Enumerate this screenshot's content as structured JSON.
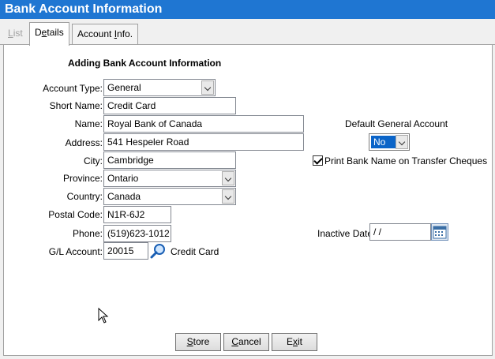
{
  "window": {
    "title": "Bank Account Information"
  },
  "tabs": {
    "list": {
      "first": "L",
      "rest": "ist"
    },
    "details": {
      "pre": "D",
      "mid": "e",
      "rest": "tails"
    },
    "account_info": {
      "pre": "Account ",
      "mid": "I",
      "rest": "nfo."
    }
  },
  "form": {
    "section_title": "Adding Bank Account Information",
    "account_type": {
      "label": "Account Type:",
      "value": "General"
    },
    "short_name": {
      "label": "Short Name:",
      "value": "Credit Card"
    },
    "name": {
      "label": "Name:",
      "value": "Royal Bank of Canada"
    },
    "address": {
      "label": "Address:",
      "value": "541 Hespeler Road"
    },
    "city": {
      "label": "City:",
      "value": "Cambridge"
    },
    "province": {
      "label": "Province:",
      "value": "Ontario"
    },
    "country": {
      "label": "Country:",
      "value": "Canada"
    },
    "postal_code": {
      "label": "Postal Code:",
      "value": "N1R-6J2"
    },
    "phone": {
      "label": "Phone:",
      "value": "(519)623-1012"
    },
    "gl_account": {
      "label": "G/L Account:",
      "value": "20015",
      "description": "Credit Card"
    },
    "default_general_account": {
      "label": "Default General Account",
      "value": "No"
    },
    "print_bank_name": {
      "label": "Print Bank Name on Transfer Cheques",
      "checked": true
    },
    "inactive_date": {
      "label": "Inactive Date:",
      "value": " / /"
    }
  },
  "buttons": {
    "store": {
      "first": "S",
      "rest": "tore"
    },
    "cancel": {
      "first": "C",
      "rest": "ancel"
    },
    "exit": {
      "pre": "E",
      "mid": "x",
      "rest": "it"
    }
  },
  "colors": {
    "title_bar": "#1f76d2",
    "selection": "#0a64c8"
  }
}
